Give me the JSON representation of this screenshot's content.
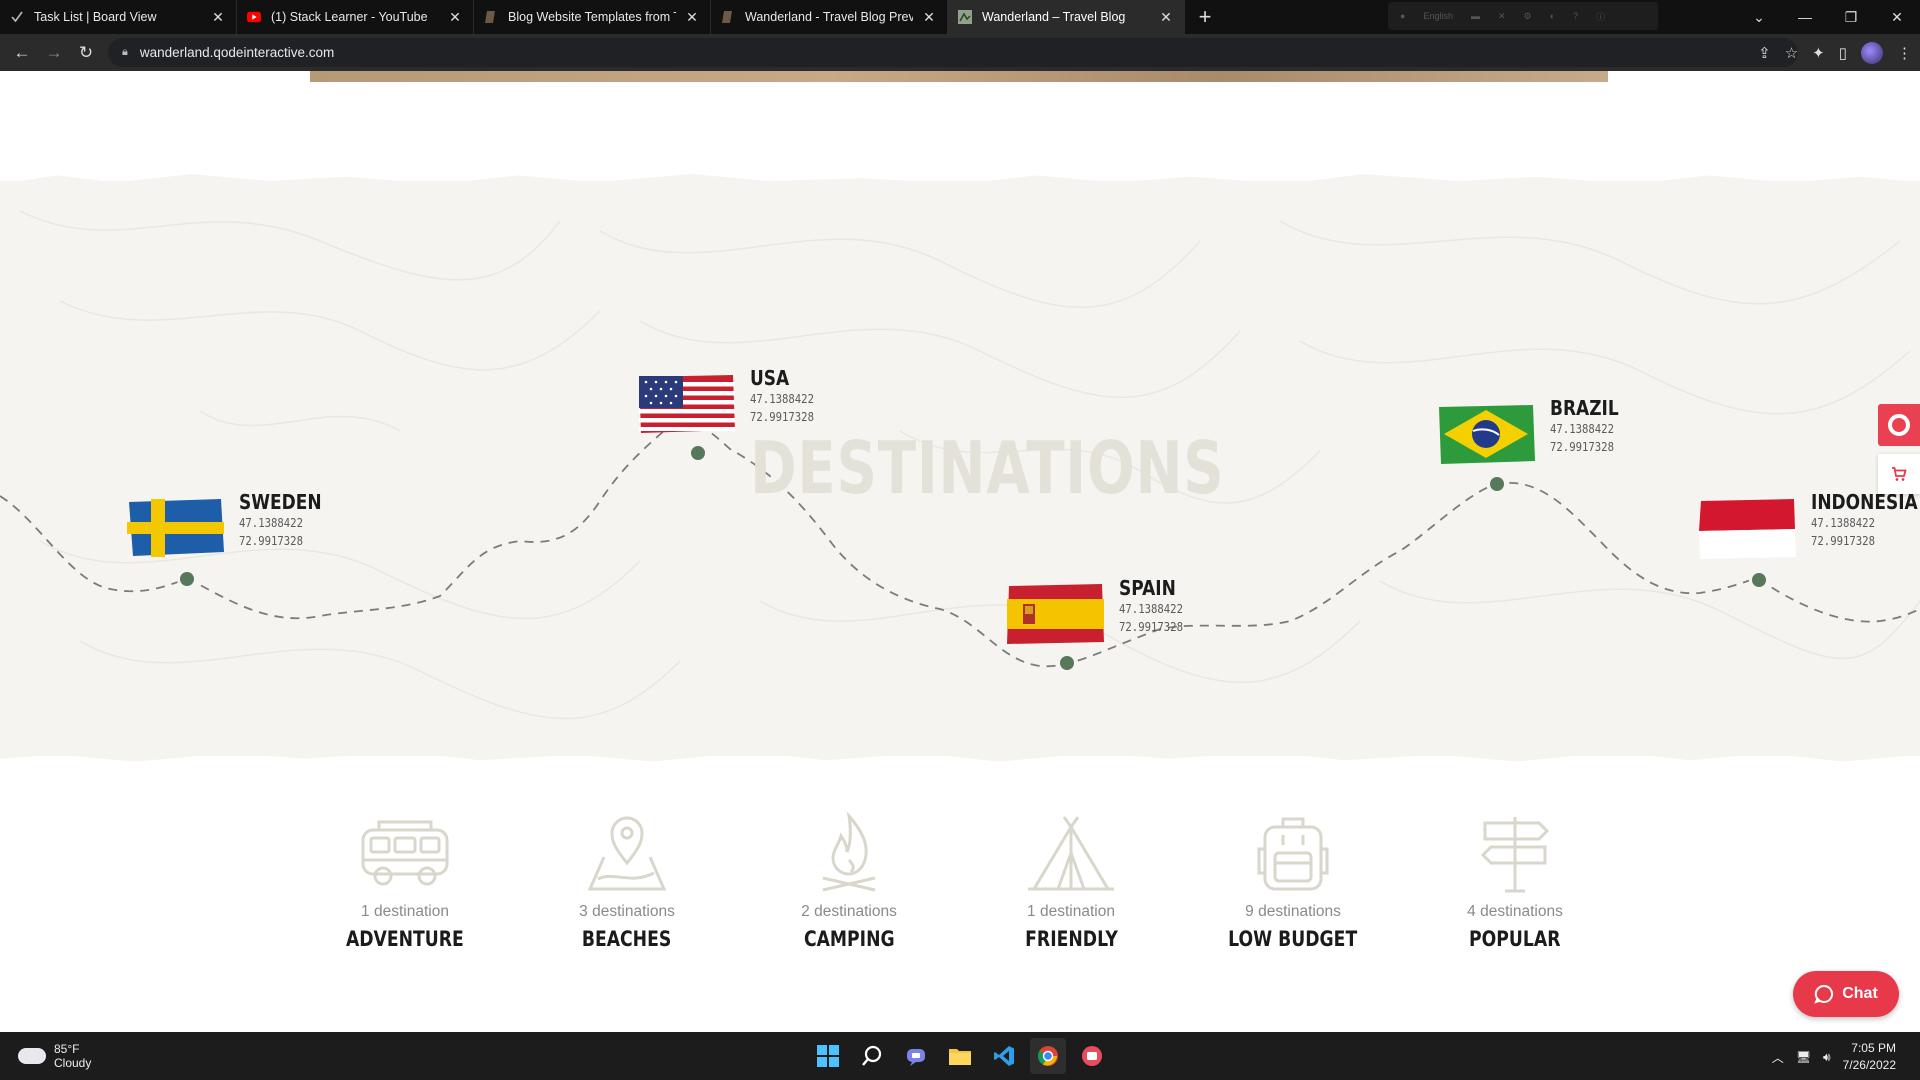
{
  "browser": {
    "tabs": [
      {
        "title": "Task List | Board View",
        "icon": "checkmark-icon",
        "active": false
      },
      {
        "title": "(1) Stack Learner - YouTube",
        "icon": "youtube-icon",
        "active": false
      },
      {
        "title": "Blog Website Templates from Th",
        "icon": "qode-icon",
        "active": false
      },
      {
        "title": "Wanderland - Travel Blog Preview",
        "icon": "qode-icon",
        "active": false
      },
      {
        "title": "Wanderland – Travel Blog",
        "icon": "wanderland-icon",
        "active": true
      }
    ],
    "url": "wanderland.qodeinteractive.com",
    "extension_label": "English"
  },
  "map": {
    "heading": "DESTINATIONS",
    "pins": [
      {
        "name": "SWEDEN",
        "lat": "47.1388422",
        "lng": "72.9917328",
        "flag": "sweden-flag"
      },
      {
        "name": "USA",
        "lat": "47.1388422",
        "lng": "72.9917328",
        "flag": "usa-flag"
      },
      {
        "name": "SPAIN",
        "lat": "47.1388422",
        "lng": "72.9917328",
        "flag": "spain-flag"
      },
      {
        "name": "BRAZIL",
        "lat": "47.1388422",
        "lng": "72.9917328",
        "flag": "brazil-flag"
      },
      {
        "name": "INDONESIA",
        "lat": "47.1388422",
        "lng": "72.9917328",
        "flag": "indonesia-flag"
      }
    ],
    "colors": {
      "dot": "#57785a",
      "band": "#f5f4f0"
    }
  },
  "categories": [
    {
      "count": "1 destination",
      "label": "ADVENTURE",
      "icon": "van-icon"
    },
    {
      "count": "3 destinations",
      "label": "BEACHES",
      "icon": "map-pin-icon"
    },
    {
      "count": "2 destinations",
      "label": "CAMPING",
      "icon": "campfire-icon"
    },
    {
      "count": "1 destination",
      "label": "FRIENDLY",
      "icon": "tent-icon"
    },
    {
      "count": "9 destinations",
      "label": "LOW BUDGET",
      "icon": "backpack-icon"
    },
    {
      "count": "4 destinations",
      "label": "POPULAR",
      "icon": "signpost-icon"
    }
  ],
  "widgets": {
    "chat_label": "Chat",
    "accent": "#e8394a"
  },
  "taskbar": {
    "temperature": "85°F",
    "condition": "Cloudy",
    "time": "7:05 PM",
    "date": "7/26/2022"
  }
}
